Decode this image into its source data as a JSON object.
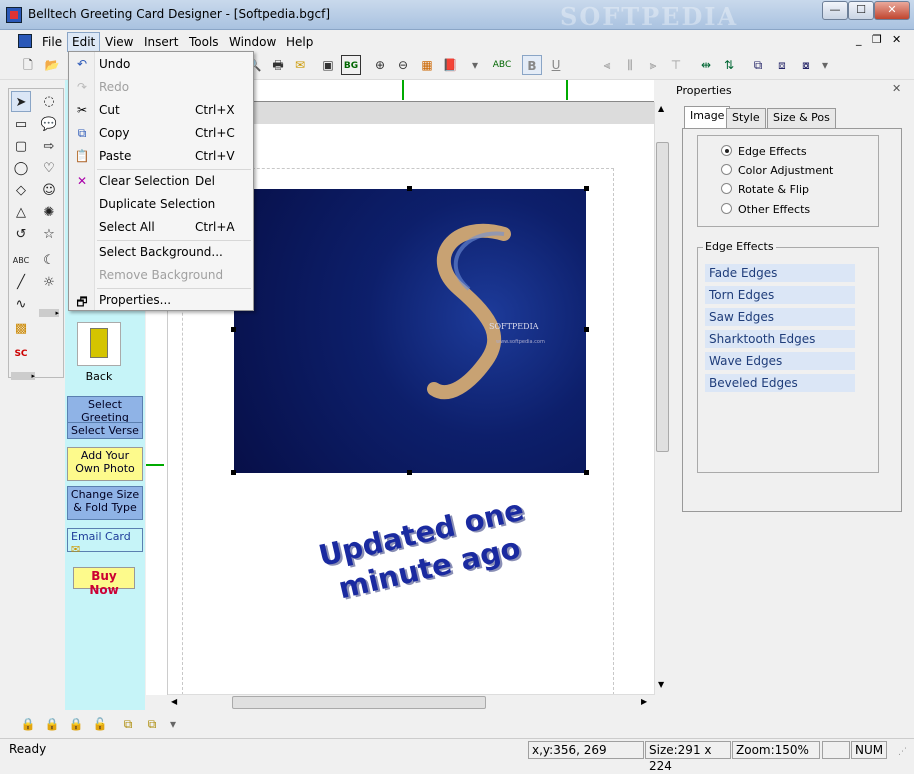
{
  "window": {
    "title": "Belltech Greeting Card Designer  - [Softpedia.bgcf]",
    "watermark": "SOFTPEDIA",
    "controls": {
      "minimize": "—",
      "maximize": "☐",
      "close": "✕"
    }
  },
  "menubar": {
    "items": [
      "File",
      "Edit",
      "View",
      "Insert",
      "Tools",
      "Window",
      "Help"
    ],
    "open_menu": "Edit",
    "mdi_controls": {
      "minimize": "_",
      "restore": "❐",
      "close": "✕"
    }
  },
  "edit_menu": {
    "items": [
      {
        "label": "Undo",
        "shortcut": "",
        "enabled": true,
        "icon": "undo-icon"
      },
      {
        "label": "Redo",
        "shortcut": "",
        "enabled": false,
        "icon": "redo-icon"
      },
      {
        "label": "Cut",
        "shortcut": "Ctrl+X",
        "enabled": true,
        "icon": "scissors-icon"
      },
      {
        "label": "Copy",
        "shortcut": "Ctrl+C",
        "enabled": true,
        "icon": "copy-icon"
      },
      {
        "label": "Paste",
        "shortcut": "Ctrl+V",
        "enabled": true,
        "icon": "paste-icon"
      },
      {
        "label": "Clear Selection",
        "shortcut": "Del",
        "enabled": true,
        "icon": "clear-icon"
      },
      {
        "label": "Duplicate Selection",
        "shortcut": "",
        "enabled": true,
        "icon": ""
      },
      {
        "label": "Select All",
        "shortcut": "Ctrl+A",
        "enabled": true,
        "icon": ""
      },
      {
        "label": "Select Background...",
        "shortcut": "",
        "enabled": true,
        "icon": ""
      },
      {
        "label": "Remove Background",
        "shortcut": "",
        "enabled": false,
        "icon": ""
      },
      {
        "label": "Properties...",
        "shortcut": "",
        "enabled": true,
        "icon": "properties-icon"
      }
    ]
  },
  "toolbar": {
    "buttons": [
      "new",
      "open",
      "print",
      "print-preview",
      "mail",
      "insert-image",
      "background",
      "zoom-in",
      "zoom-out",
      "grid",
      "book",
      "spell-check",
      "bold",
      "underline",
      "align-left",
      "align-center",
      "align-right",
      "align-top",
      "align-middle",
      "align-bottom",
      "flip-horizontal",
      "flip-vertical",
      "group",
      "ungroup"
    ],
    "bg_label": "BG",
    "abc_label": "ABC",
    "bold_label": "B",
    "underline_label": "U"
  },
  "palette": {
    "tools": [
      "select",
      "lasso",
      "rectangle",
      "callout",
      "rounded-rectangle",
      "arrow",
      "ellipse",
      "heart",
      "diamond",
      "smiley",
      "triangle",
      "burst",
      "spiral",
      "star",
      "text",
      "moon",
      "line",
      "sun",
      "curve",
      "image",
      "clipart"
    ],
    "text_tool_label": "ABC"
  },
  "wizard": {
    "back_label": "Back",
    "buttons": [
      "Select Greeting",
      "Select Verse",
      "Add Your Own Photo",
      "Change Size & Fold Type",
      "Email Card",
      "Buy Now"
    ]
  },
  "canvas": {
    "card_text_line1": "Updated one",
    "card_text_line2": "minute ago",
    "photo_caption": "SOFTPEDIA",
    "photo_url_text": "www.softpedia.com"
  },
  "properties": {
    "title": "Properties",
    "tabs": [
      "Image",
      "Style",
      "Size & Pos"
    ],
    "active_tab": "Image",
    "radios": [
      {
        "label": "Edge Effects",
        "checked": true
      },
      {
        "label": "Color Adjustment",
        "checked": false
      },
      {
        "label": "Rotate & Flip",
        "checked": false
      },
      {
        "label": "Other Effects",
        "checked": false
      }
    ],
    "group_title": "Edge Effects",
    "edge_effects": [
      "Fade Edges",
      "Torn Edges",
      "Saw Edges",
      "Sharktooth Edges",
      "Wave Edges",
      "Beveled Edges"
    ]
  },
  "status": {
    "ready": "Ready",
    "coords": "x,y:356, 269",
    "size": "Size:291 x 224",
    "zoom": "Zoom:150%",
    "num": "NUM"
  }
}
